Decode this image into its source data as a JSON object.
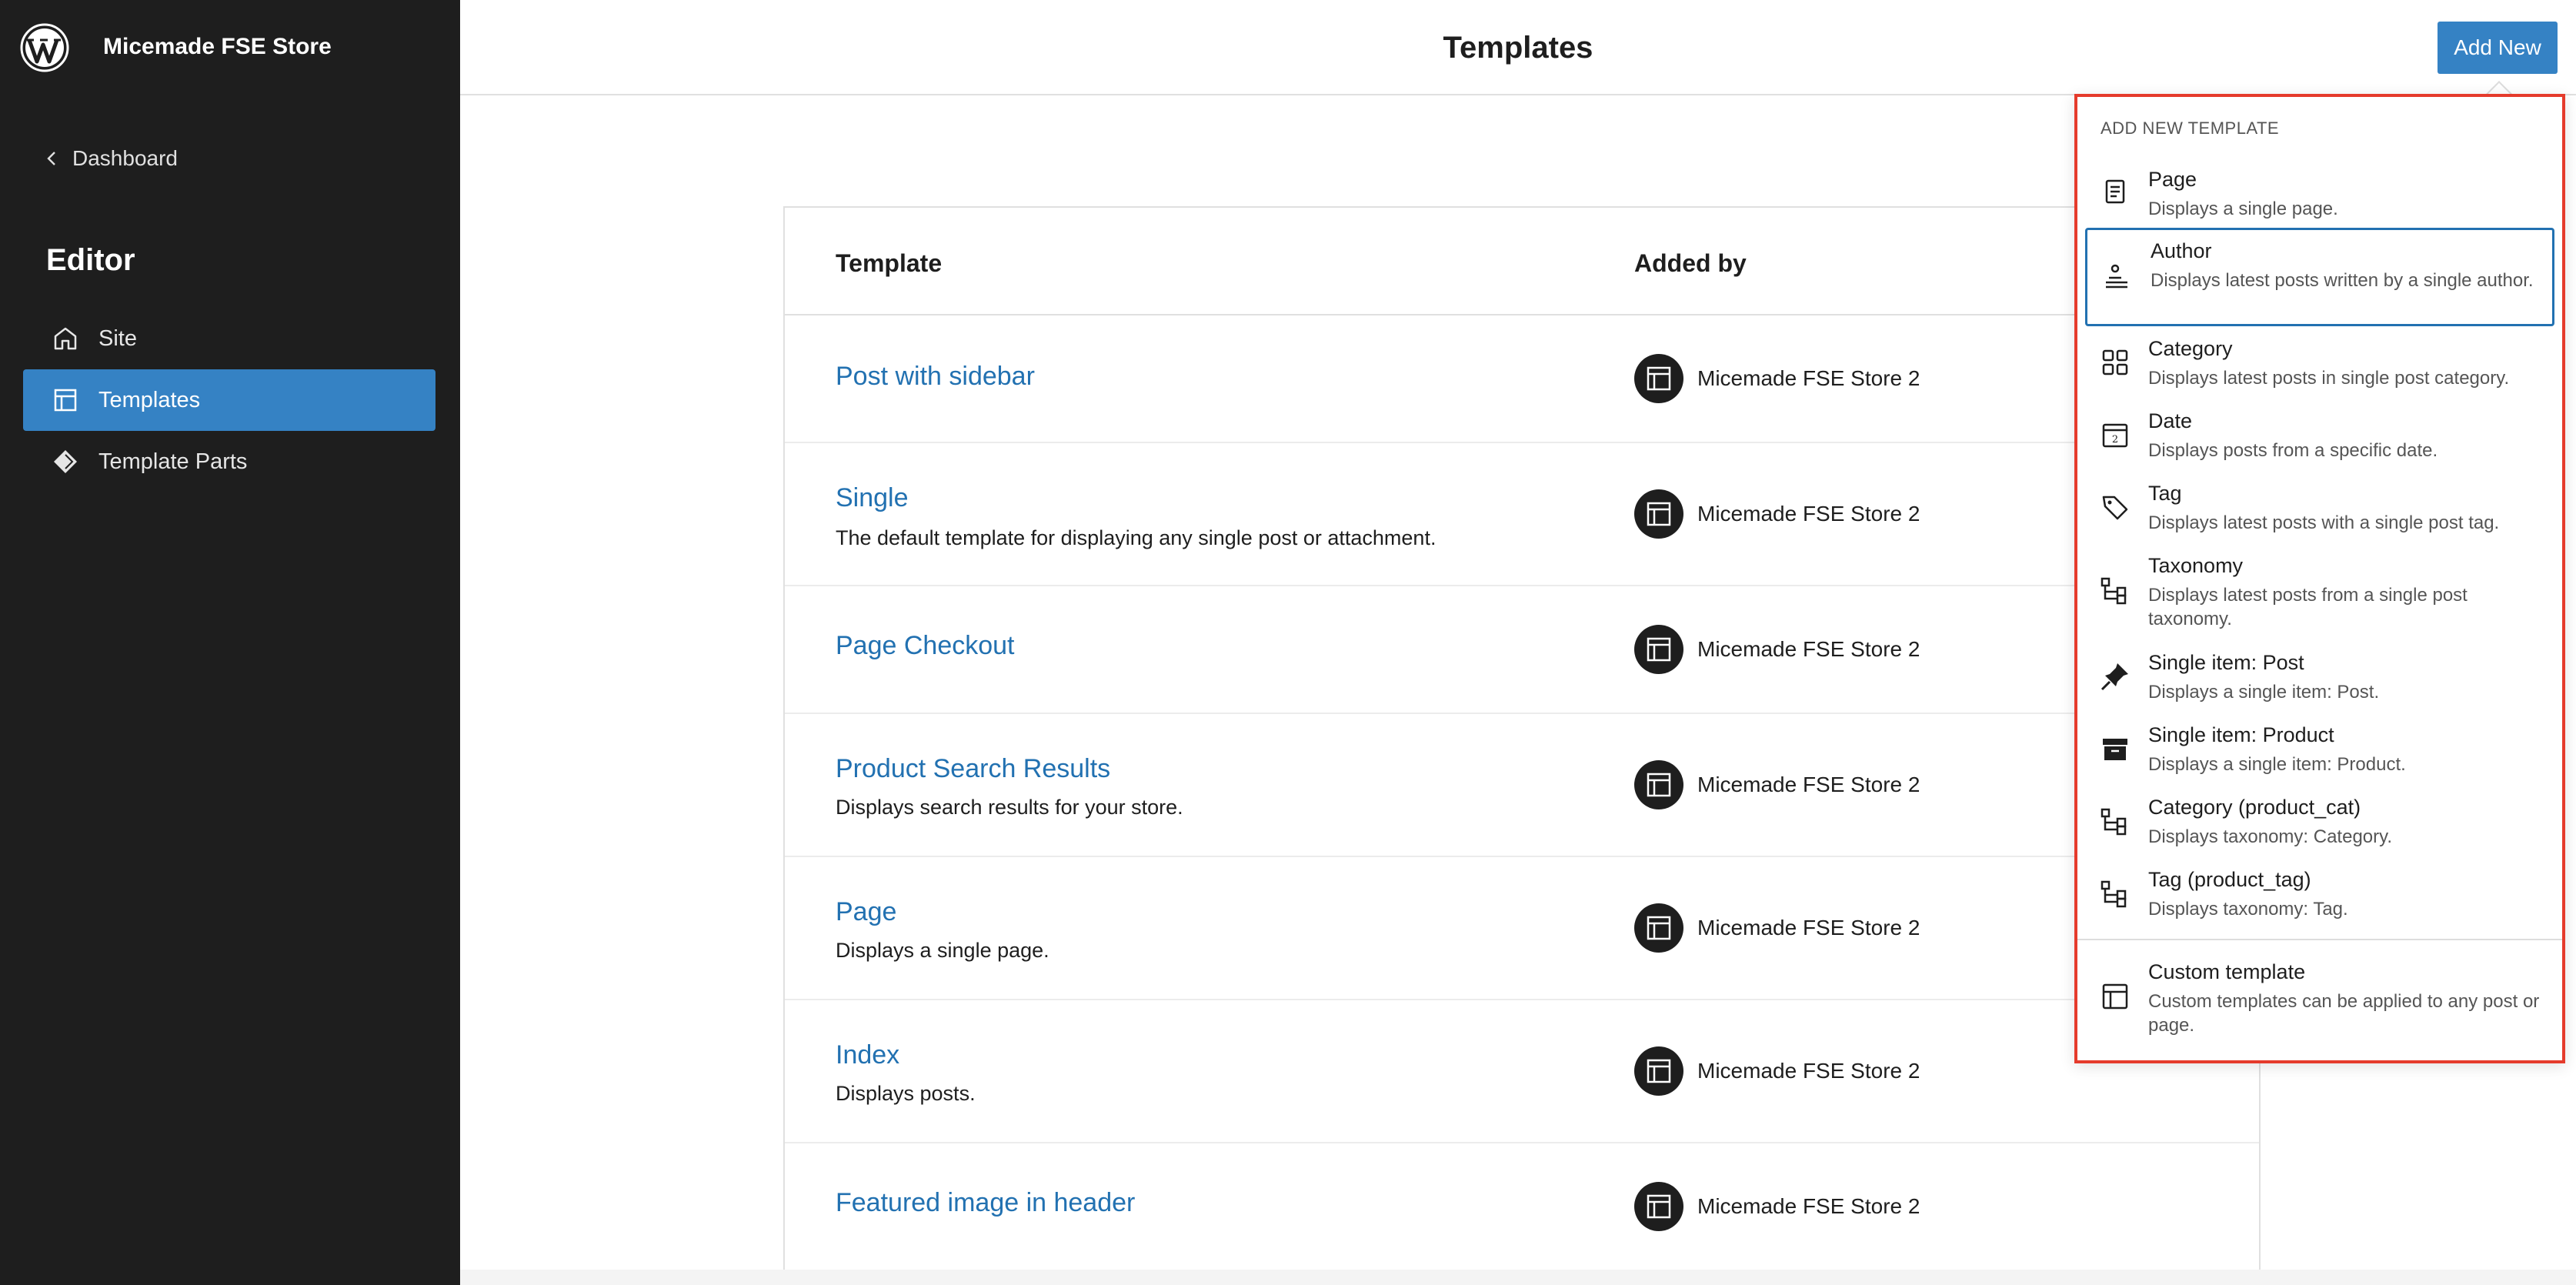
{
  "sidebar": {
    "site_name": "Micemade FSE Store",
    "back_label": "Dashboard",
    "heading": "Editor",
    "items": [
      {
        "label": "Site",
        "icon": "home-icon",
        "active": false
      },
      {
        "label": "Templates",
        "icon": "layout-icon",
        "active": true
      },
      {
        "label": "Template Parts",
        "icon": "symbol-filled-icon",
        "active": false
      }
    ]
  },
  "header": {
    "title": "Templates",
    "add_new_label": "Add New"
  },
  "table": {
    "columns": [
      "Template",
      "Added by"
    ],
    "rows": [
      {
        "title": "Post with sidebar",
        "description": "",
        "added_by": "Micemade FSE Store 2"
      },
      {
        "title": "Single",
        "description": "The default template for displaying any single post or attachment.",
        "added_by": "Micemade FSE Store 2"
      },
      {
        "title": "Page Checkout",
        "description": "",
        "added_by": "Micemade FSE Store 2"
      },
      {
        "title": "Product Search Results",
        "description": "Displays search results for your store.",
        "added_by": "Micemade FSE Store 2"
      },
      {
        "title": "Page",
        "description": "Displays a single page.",
        "added_by": "Micemade FSE Store 2"
      },
      {
        "title": "Index",
        "description": "Displays posts.",
        "added_by": "Micemade FSE Store 2"
      },
      {
        "title": "Featured image in header",
        "description": "",
        "added_by": "Micemade FSE Store 2"
      }
    ]
  },
  "popover": {
    "heading": "ADD NEW TEMPLATE",
    "items": [
      {
        "title": "Page",
        "description": "Displays a single page.",
        "icon": "page-icon"
      },
      {
        "title": "Author",
        "description": "Displays latest posts written by a single author.",
        "icon": "author-icon"
      },
      {
        "title": "Category",
        "description": "Displays latest posts in single post category.",
        "icon": "category-icon"
      },
      {
        "title": "Date",
        "description": "Displays posts from a specific date.",
        "icon": "calendar-icon"
      },
      {
        "title": "Tag",
        "description": "Displays latest posts with a single post tag.",
        "icon": "tag-icon"
      },
      {
        "title": "Taxonomy",
        "description": "Displays latest posts from a single post taxonomy.",
        "icon": "taxonomy-icon"
      },
      {
        "title": "Single item: Post",
        "description": "Displays a single item: Post.",
        "icon": "pin-icon"
      },
      {
        "title": "Single item: Product",
        "description": "Displays a single item: Product.",
        "icon": "archive-icon"
      },
      {
        "title": "Category (product_cat)",
        "description": "Displays taxonomy: Category.",
        "icon": "taxonomy-icon"
      },
      {
        "title": "Tag (product_tag)",
        "description": "Displays taxonomy: Tag.",
        "icon": "taxonomy-icon"
      }
    ],
    "custom": {
      "title": "Custom template",
      "description": "Custom templates can be applied to any post or page.",
      "icon": "layout-icon"
    }
  }
}
